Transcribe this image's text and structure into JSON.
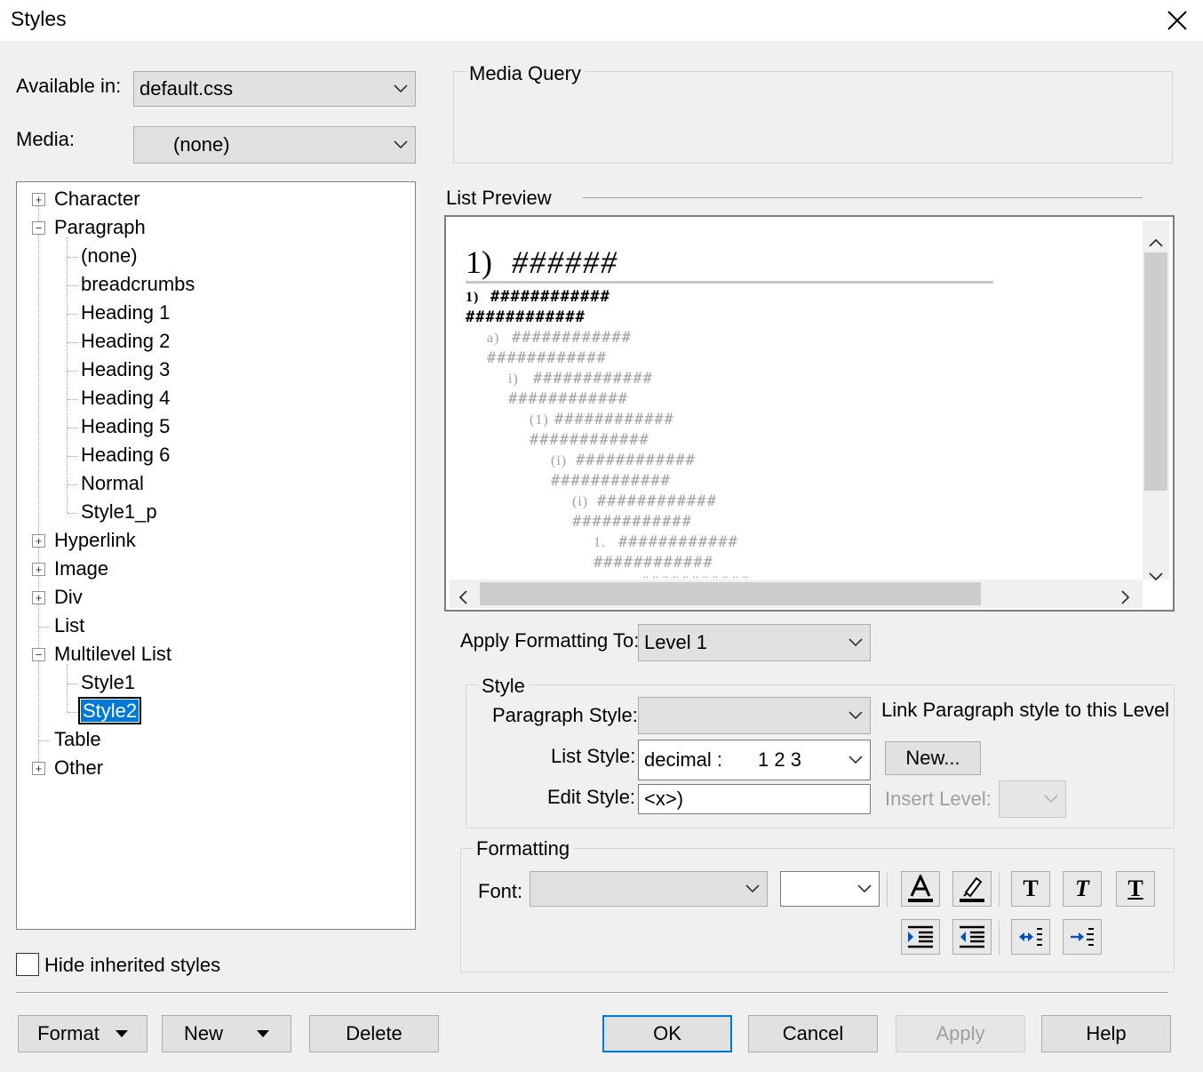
{
  "window": {
    "title": "Styles",
    "close_glyph": "✕"
  },
  "available_in": {
    "label": "Available in:",
    "value": "default.css"
  },
  "media": {
    "label": "Media:",
    "value": "(none)"
  },
  "media_query": {
    "label": "Media Query",
    "value": ""
  },
  "tree": {
    "nodes": [
      {
        "label": "Character",
        "expander": "+",
        "level": 0
      },
      {
        "label": "Paragraph",
        "expander": "−",
        "level": 0
      },
      {
        "label": "(none)",
        "level": 1
      },
      {
        "label": "breadcrumbs",
        "level": 1
      },
      {
        "label": "Heading 1",
        "level": 1
      },
      {
        "label": "Heading 2",
        "level": 1
      },
      {
        "label": "Heading 3",
        "level": 1
      },
      {
        "label": "Heading 4",
        "level": 1
      },
      {
        "label": "Heading 5",
        "level": 1
      },
      {
        "label": "Heading 6",
        "level": 1
      },
      {
        "label": "Normal",
        "level": 1
      },
      {
        "label": "Style1_p",
        "level": 1
      },
      {
        "label": "Hyperlink",
        "expander": "+",
        "level": 0
      },
      {
        "label": "Image",
        "expander": "+",
        "level": 0
      },
      {
        "label": "Div",
        "expander": "+",
        "level": 0
      },
      {
        "label": "List",
        "level": 0
      },
      {
        "label": "Multilevel List",
        "expander": "−",
        "level": 0
      },
      {
        "label": "Style1",
        "level": 1
      },
      {
        "label": "Style2",
        "level": 1,
        "selected": true
      },
      {
        "label": "Table",
        "level": 0
      },
      {
        "label": "Other",
        "expander": "+",
        "level": 0
      }
    ]
  },
  "hide_inherited": {
    "label": "Hide inherited styles",
    "checked": false
  },
  "list_preview": {
    "label": "List Preview",
    "heading_marker": "1)",
    "heading_text": "######",
    "lines": [
      {
        "marker": "1)",
        "text": "############",
        "shade": "#000"
      },
      {
        "marker": "",
        "text": "############",
        "shade": "#000"
      },
      {
        "marker": "a)",
        "text": "############",
        "shade": "#a0a0a0"
      },
      {
        "marker": "",
        "text": "############",
        "shade": "#a0a0a0"
      },
      {
        "marker": "i)",
        "text": "############",
        "shade": "#a0a0a0"
      },
      {
        "marker": "",
        "text": "############",
        "shade": "#a0a0a0"
      },
      {
        "marker": "(1)",
        "text": "############",
        "shade": "#a0a0a0"
      },
      {
        "marker": "",
        "text": "############",
        "shade": "#a0a0a0"
      },
      {
        "marker": "(i)",
        "text": "############",
        "shade": "#a0a0a0"
      },
      {
        "marker": "",
        "text": "############",
        "shade": "#a0a0a0"
      },
      {
        "marker": "(i)",
        "text": "############",
        "shade": "#a0a0a0"
      },
      {
        "marker": "",
        "text": "############",
        "shade": "#a0a0a0"
      },
      {
        "marker": "1.",
        "text": "############",
        "shade": "#a0a0a0"
      },
      {
        "marker": "",
        "text": "############",
        "shade": "#a0a0a0"
      },
      {
        "marker": "-",
        "text": "###########",
        "shade": "#a0a0a0"
      }
    ]
  },
  "apply_formatting": {
    "label": "Apply Formatting To:",
    "value": "Level 1"
  },
  "style_group": {
    "label": "Style",
    "paragraph_style_label": "Paragraph Style:",
    "paragraph_style_value": "",
    "link_label": "Link Paragraph style to this Level",
    "list_style_label": "List Style:",
    "list_style_value": "decimal :",
    "list_style_sample": "1 2 3",
    "new_button": "New...",
    "edit_style_label": "Edit Style:",
    "edit_style_value": "<x>)",
    "insert_level_label": "Insert Level:"
  },
  "formatting_group": {
    "label": "Formatting",
    "font_label": "Font:",
    "font_value": "",
    "size_value": ""
  },
  "buttons": {
    "format": "Format",
    "new": "New",
    "delete": "Delete",
    "ok": "OK",
    "cancel": "Cancel",
    "apply": "Apply",
    "help": "Help"
  },
  "colors": {
    "selection": "#0078d7",
    "default_button_border": "#0078d7"
  }
}
